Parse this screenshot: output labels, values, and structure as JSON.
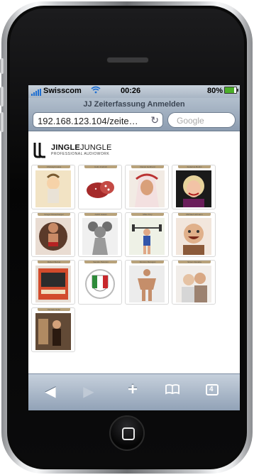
{
  "status": {
    "carrier": "Swisscom",
    "time": "00:26",
    "battery_text": "80%",
    "battery_level": 0.8
  },
  "browser": {
    "page_title": "JJ Zeiterfassung Anmelden",
    "url": "192.168.123.104/zeite…",
    "search_placeholder": "Google",
    "tab_count": "4"
  },
  "logo": {
    "name_bold": "JINGLE",
    "name_rest": "JUNGLE",
    "tagline": "PROFESSIONAL AUDIOWORK"
  },
  "users": [
    {
      "name": "Christoph Hess",
      "image": "cartoon-guy"
    },
    {
      "name": "Colin Jindrich",
      "image": "salami"
    },
    {
      "name": "Daniel Gebhard",
      "image": "arab-man"
    },
    {
      "name": "Federica Bodini",
      "image": "woman-portrait"
    },
    {
      "name": "Gregor Rosenberger",
      "image": "wrestler"
    },
    {
      "name": "Judith Hasan",
      "image": "mouse-figure"
    },
    {
      "name": "Mike Frey",
      "image": "weightlifter"
    },
    {
      "name": "Michael Hofmann",
      "image": "laughing-man"
    },
    {
      "name": "Robert Burkel",
      "image": "poster"
    },
    {
      "name": "Sandro Pelonini",
      "image": "italy-crest"
    },
    {
      "name": "Simone Marugan",
      "image": "bodybuilder"
    },
    {
      "name": "Simon Zanatta",
      "image": "couple"
    },
    {
      "name": "Yannick Hofer",
      "image": "movie-still"
    }
  ],
  "toolbar": {
    "back": "◀",
    "forward": "▶",
    "add": "+",
    "bookmarks": "📖"
  }
}
